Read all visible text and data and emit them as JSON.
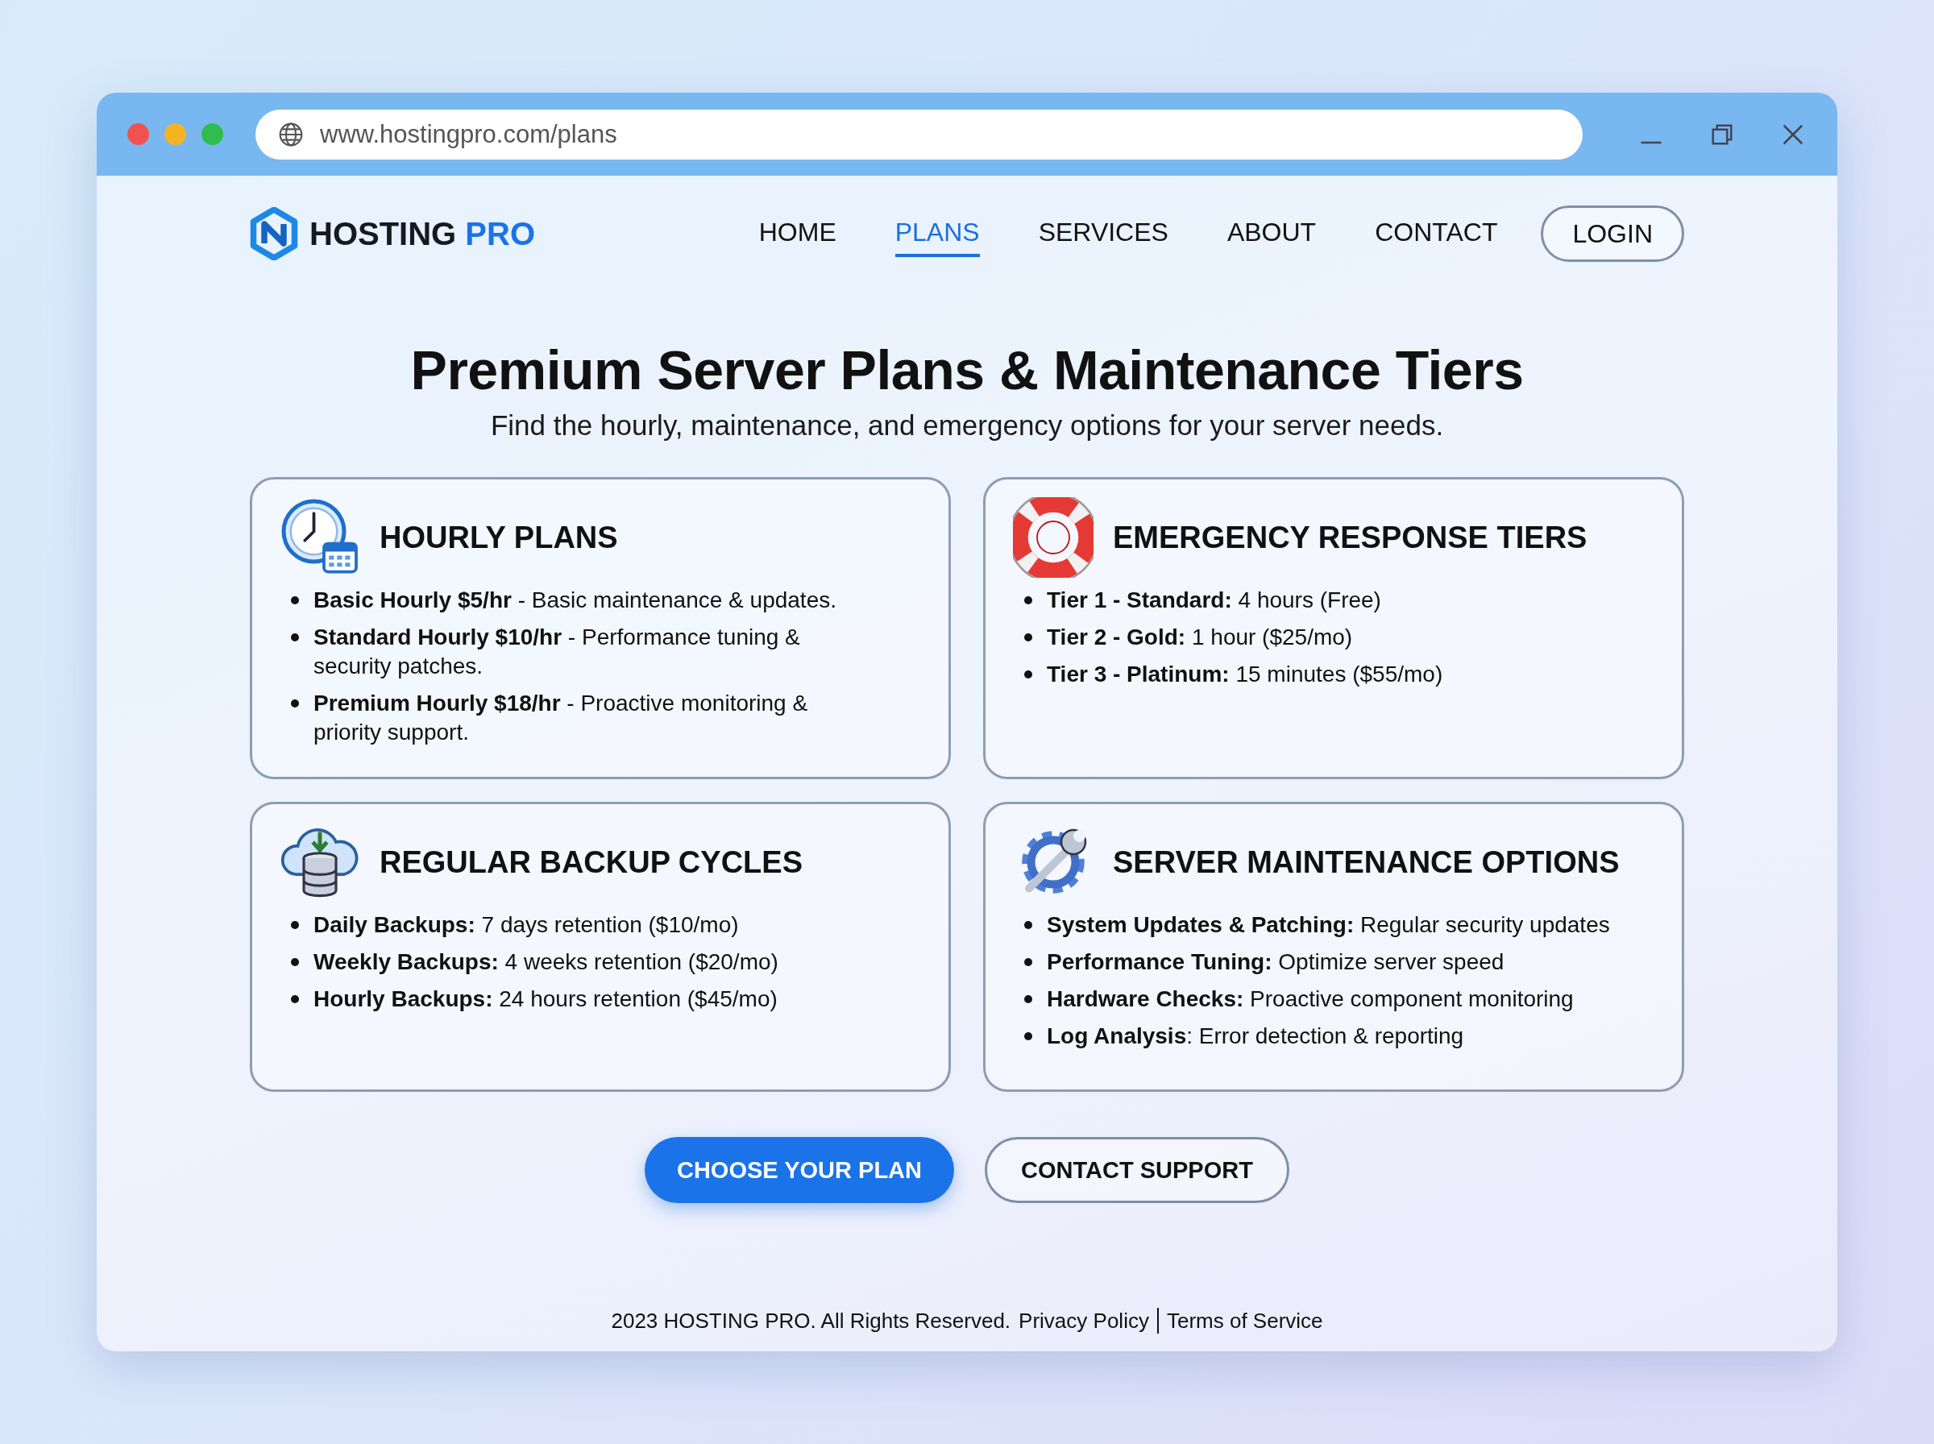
{
  "browser": {
    "url": "www.hostingpro.com/plans"
  },
  "brand": {
    "name": "HOSTING",
    "accent": "PRO"
  },
  "nav": [
    {
      "label": "HOME",
      "selected": false
    },
    {
      "label": "PLANS",
      "selected": true
    },
    {
      "label": "SERVICES",
      "selected": false
    },
    {
      "label": "ABOUT",
      "selected": false
    },
    {
      "label": "CONTACT",
      "selected": false
    }
  ],
  "login": "LOGIN",
  "heading": "Premium Server Plans & Maintenance Tiers",
  "subheading": "Find the hourly, maintenance, and emergency options for your server needs.",
  "cards": [
    {
      "kind": "clock-calendar",
      "title": "HOURLY PLANS",
      "items": [
        "**Basic Hourly $5/hr** - Basic maintenance & updates.",
        "**Standard Hourly $10/hr** - Performance tuning & security patches.",
        "**Premium Hourly $18/hr** - Proactive monitoring & priority support."
      ]
    },
    {
      "kind": "lifebuoy",
      "title": "EMERGENCY RESPONSE TIERS",
      "items": [
        "**Tier 1 - Standard:** 4 hours (Free)",
        "**Tier 2 - Gold:** 1 hour ($25/mo)",
        "**Tier 3 - Platinum:** 15 minutes ($55/mo)"
      ]
    },
    {
      "kind": "cloud-database",
      "title": "REGULAR BACKUP CYCLES",
      "items": [
        "**Daily Backups:** 7 days retention ($10/mo)",
        "**Weekly Backups:** 4 weeks retention ($20/mo)",
        "**Hourly Backups:** 24 hours retention ($45/mo)"
      ]
    },
    {
      "kind": "gear-wrench",
      "title": "SERVER MAINTENANCE OPTIONS",
      "items": [
        "**System Updates & Patching:** Regular security updates",
        "**Performance Tuning:** Optimize server speed",
        "**Hardware Checks:** Proactive component monitoring",
        "**Log Analysis**: Error detection & reporting"
      ]
    }
  ],
  "actions": [
    {
      "label": "CHOOSE YOUR PLAN",
      "kind": "primary"
    },
    {
      "label": "CONTACT SUPPORT",
      "kind": "outline"
    }
  ],
  "footer": {
    "copyright": "2023 HOSTING PRO. All Rights Reserved.",
    "links": [
      "Privacy Policy",
      "Terms of Service"
    ]
  }
}
